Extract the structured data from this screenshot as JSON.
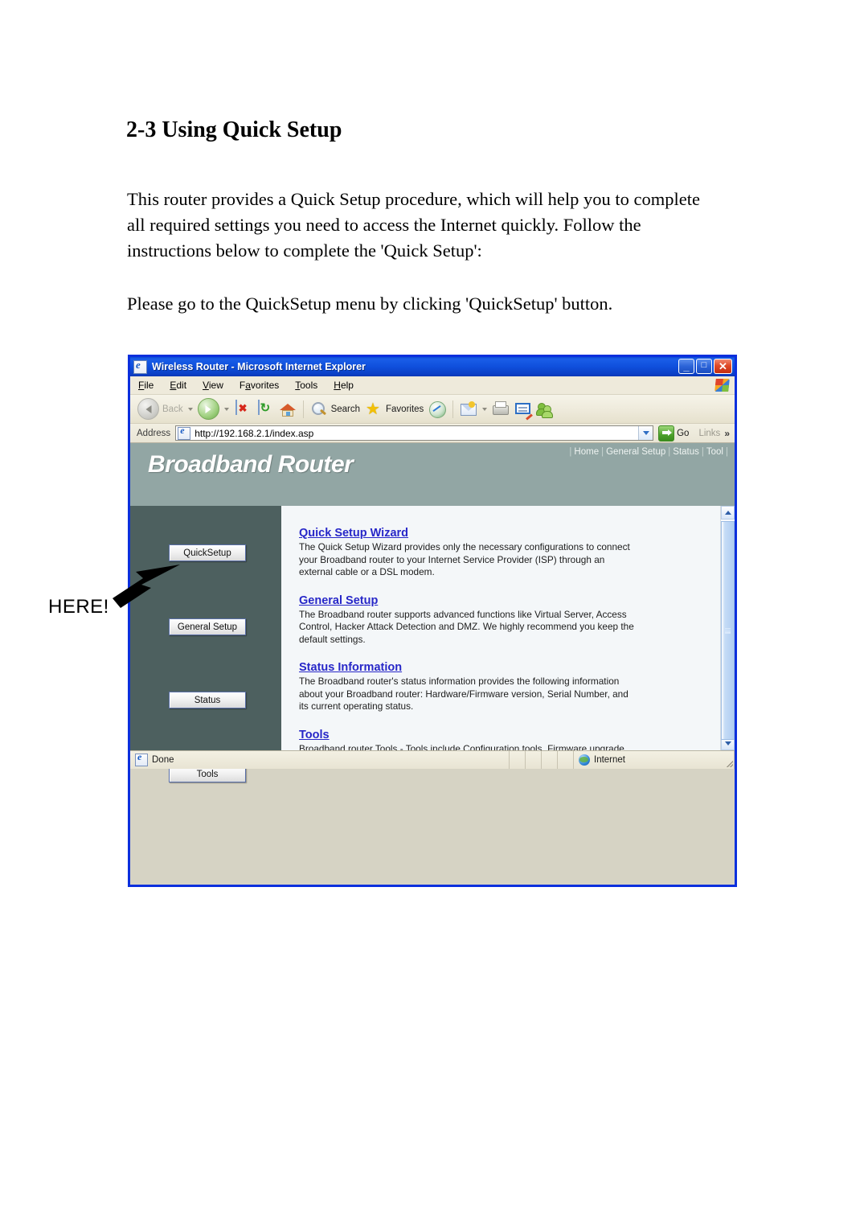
{
  "document": {
    "heading": "2-3 Using Quick Setup",
    "paragraph1": "This router provides a Quick Setup procedure, which will help you to complete all required settings you need to access the Internet quickly. Follow the instructions below to complete the 'Quick Setup':",
    "paragraph2": "Please go to the QuickSetup menu by clicking 'QuickSetup' button.",
    "annotation": "HERE!"
  },
  "browser": {
    "title": "Wireless Router - Microsoft Internet Explorer",
    "window_buttons": {
      "minimize": "_",
      "maximize": "□",
      "close": "✕"
    },
    "menus": [
      {
        "pre": "",
        "key": "F",
        "post": "ile"
      },
      {
        "pre": "",
        "key": "E",
        "post": "dit"
      },
      {
        "pre": "",
        "key": "V",
        "post": "iew"
      },
      {
        "pre": "F",
        "key": "a",
        "post": "vorites"
      },
      {
        "pre": "",
        "key": "T",
        "post": "ools"
      },
      {
        "pre": "",
        "key": "H",
        "post": "elp"
      }
    ],
    "toolbar": {
      "back_label": "Back",
      "search_label": "Search",
      "favorites_label": "Favorites"
    },
    "address": {
      "label": "Address",
      "url": "http://192.168.2.1/index.asp",
      "go_label": "Go",
      "links_label": "Links",
      "overflow": "»"
    },
    "statusbar": {
      "left_text": "Done",
      "zone_text": "Internet"
    }
  },
  "router_page": {
    "brand": "Broadband Router",
    "nav_links": [
      "Home",
      "General Setup",
      "Status",
      "Tool"
    ],
    "sidebar_buttons": [
      {
        "label": "QuickSetup"
      },
      {
        "label": "General Setup"
      },
      {
        "label": "Status"
      },
      {
        "label": "Tools"
      }
    ],
    "sections": [
      {
        "heading": "Quick Setup Wizard",
        "body": "The Quick Setup Wizard provides only the necessary configurations to connect your Broadband router to your Internet Service Provider (ISP) through an external cable or a DSL modem."
      },
      {
        "heading": "General Setup",
        "body": "The Broadband router supports advanced functions like Virtual Server, Access Control, Hacker Attack Detection and DMZ. We highly recommend you keep the default settings."
      },
      {
        "heading": "Status Information",
        "body": "The Broadband router's status information provides the following information about your Broadband router: Hardware/Firmware version, Serial Number, and its current operating status."
      },
      {
        "heading": "Tools",
        "body": "Broadband router Tools - Tools include Configuration tools, Firmware upgrade and Reset.Configuration tools allow you to Backup, Restore, or Restore to Factory Default setting for your Broadband router. The Firmware upgrade tool allows you to upgrade your Broadband router's firmware. The RESET tool allows you to reset your Broadband router."
      }
    ]
  },
  "colors": {
    "titlebar_blue": "#0f4fdc",
    "page_header": "#92a6a4",
    "sidebar": "#4d605f",
    "link_blue": "#2727c8",
    "window_border": "#0b2fdd"
  }
}
